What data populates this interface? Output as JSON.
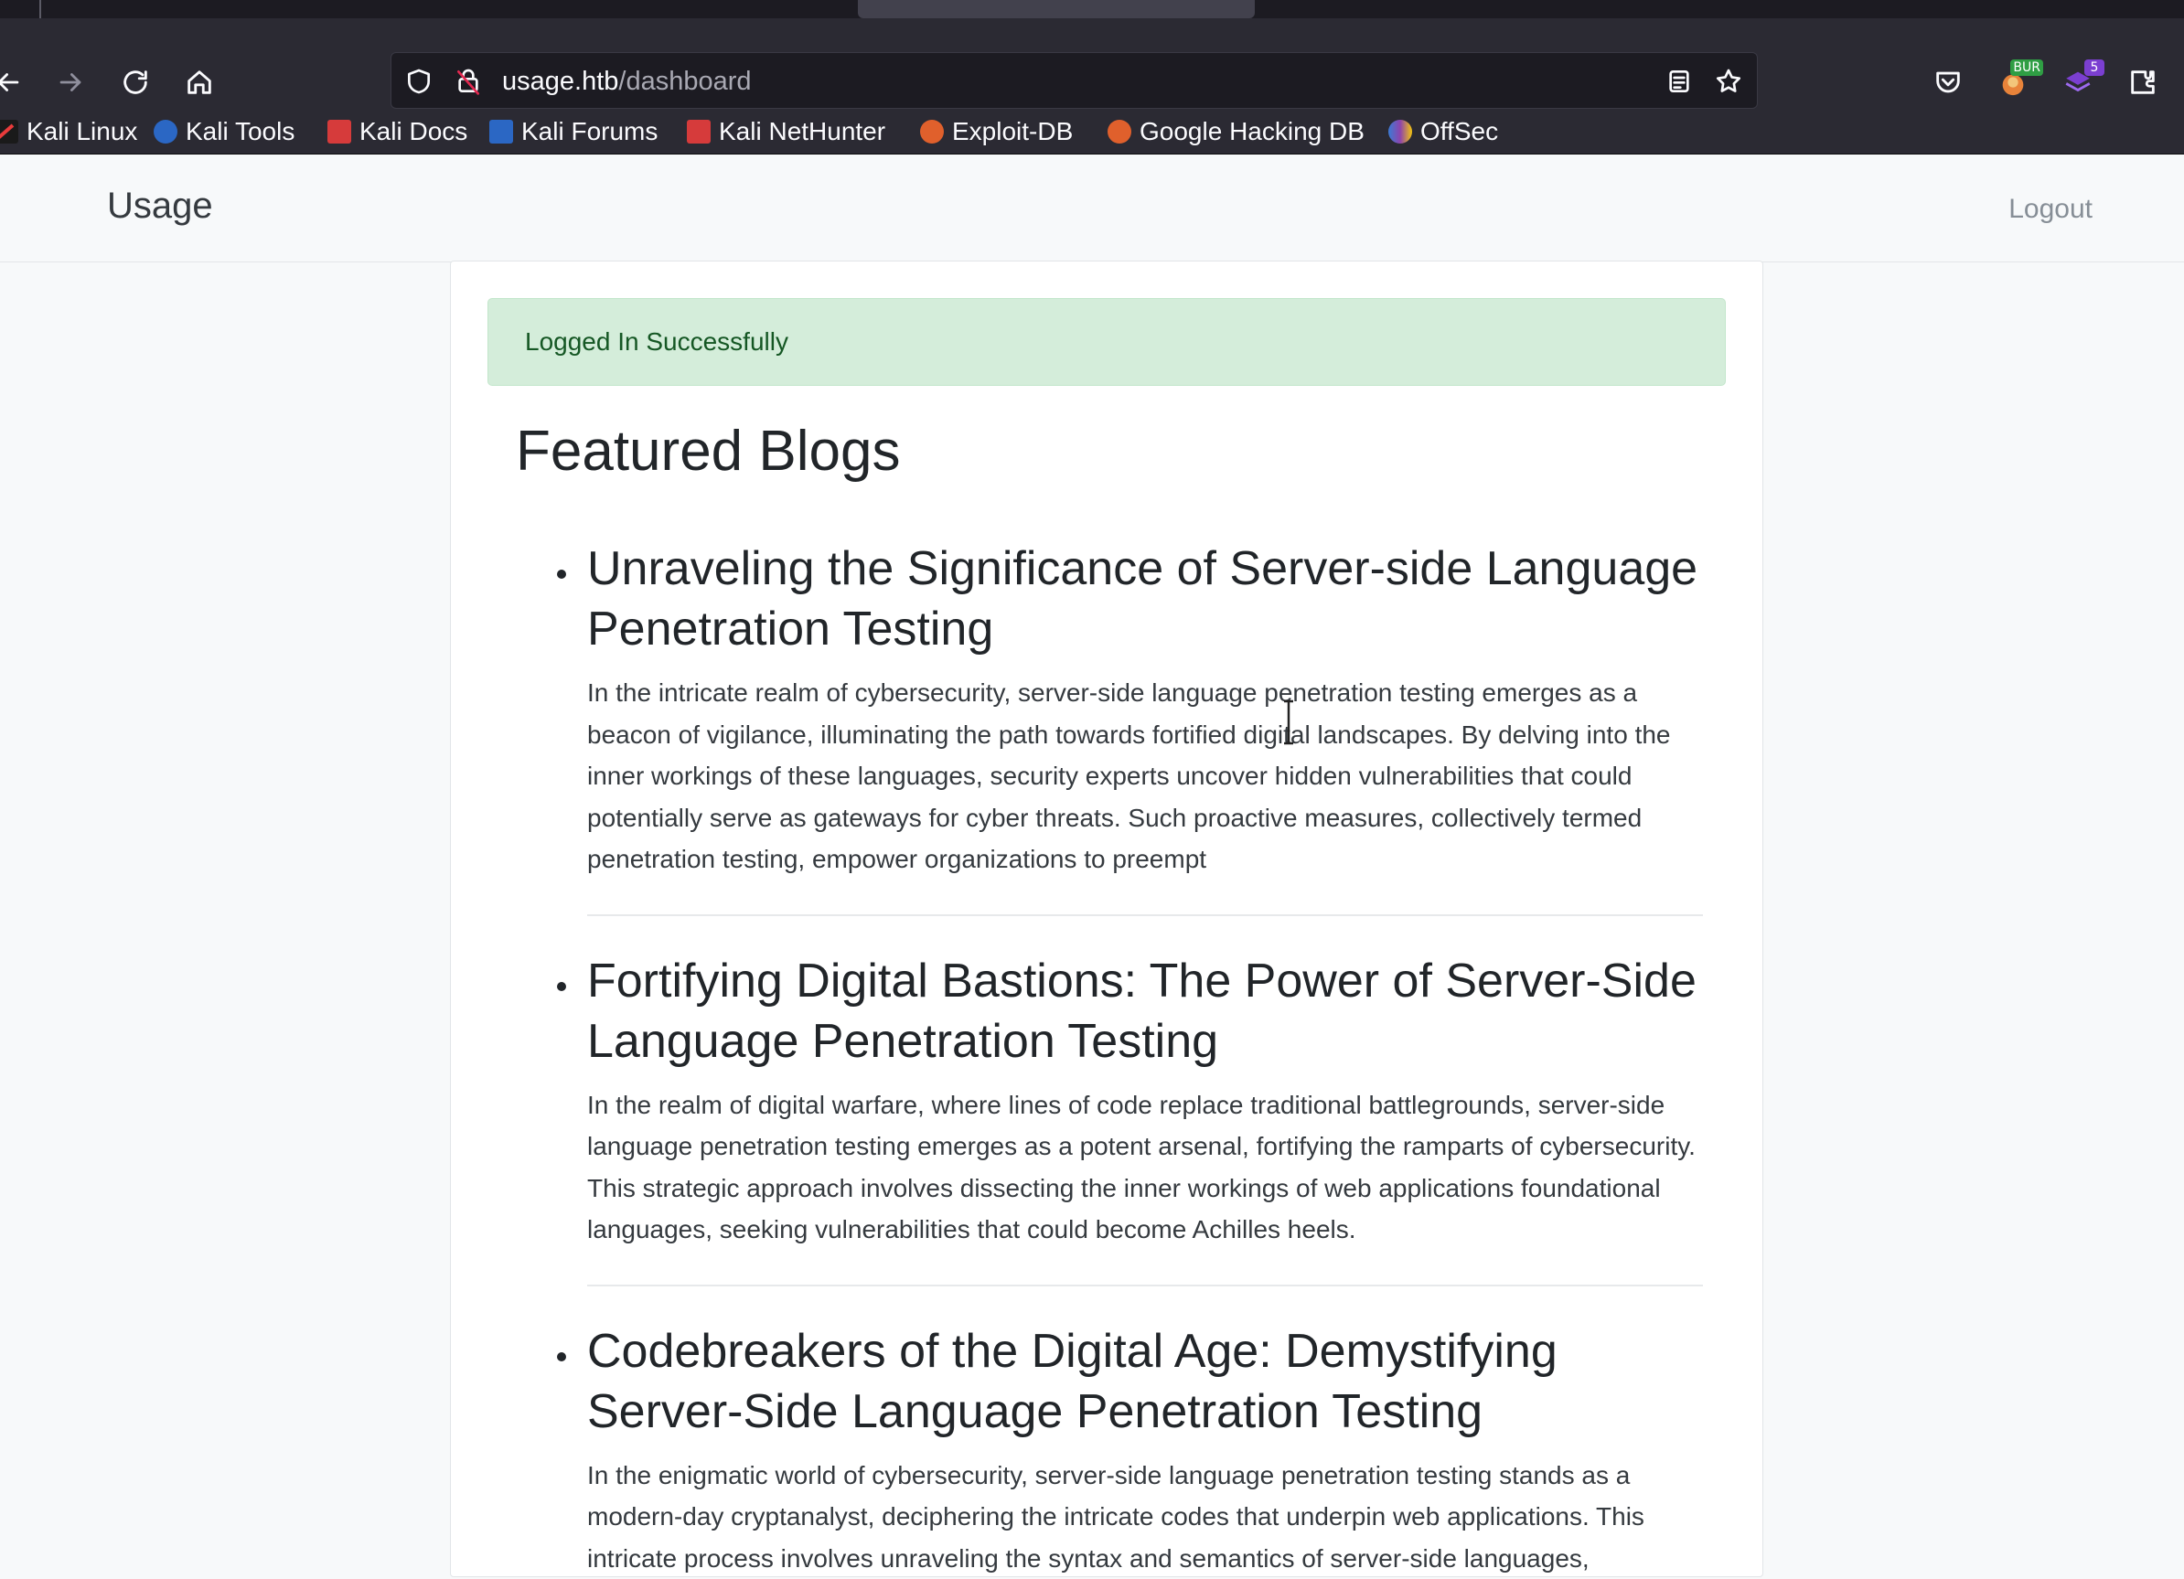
{
  "browser": {
    "url_host": "usage.htb",
    "url_path": "/dashboard",
    "bookmarks": [
      {
        "label": "Kali Linux",
        "icon": "kali-icon"
      },
      {
        "label": "Kali Tools",
        "icon": "kali-tools-icon"
      },
      {
        "label": "Kali Docs",
        "icon": "kali-docs-icon"
      },
      {
        "label": "Kali Forums",
        "icon": "kali-forums-icon"
      },
      {
        "label": "Kali NetHunter",
        "icon": "kali-nethunter-icon"
      },
      {
        "label": "Exploit-DB",
        "icon": "exploit-db-icon"
      },
      {
        "label": "Google Hacking DB",
        "icon": "ghdb-icon"
      },
      {
        "label": "OffSec",
        "icon": "offsec-icon"
      }
    ],
    "extensions": {
      "burp_badge": "BUR",
      "ext_count": "5"
    },
    "icons": {
      "back": "back-arrow-icon",
      "forward": "forward-arrow-icon",
      "reload": "reload-icon",
      "home": "home-icon",
      "shield": "tracking-shield-icon",
      "lock": "insecure-lock-icon",
      "reader": "reader-view-icon",
      "bookmark": "star-icon",
      "pocket": "pocket-icon",
      "extensions": "extensions-icon"
    }
  },
  "site": {
    "brand": "Usage",
    "logout_label": "Logout"
  },
  "alert": {
    "message": "Logged In Successfully",
    "color": "#d4edda"
  },
  "main": {
    "title": "Featured Blogs",
    "posts": [
      {
        "title": "Unraveling the Significance of Server-side Language Penetration Testing",
        "body": "In the intricate realm of cybersecurity, server-side language penetration testing emerges as a beacon of vigilance, illuminating the path towards fortified digital landscapes. By delving into the inner workings of these languages, security experts uncover hidden vulnerabilities that could potentially serve as gateways for cyber threats. Such proactive measures, collectively termed penetration testing, empower organizations to preempt"
      },
      {
        "title": "Fortifying Digital Bastions: The Power of Server-Side Language Penetration Testing",
        "body": "In the realm of digital warfare, where lines of code replace traditional battlegrounds, server-side language penetration testing emerges as a potent arsenal, fortifying the ramparts of cybersecurity. This strategic approach involves dissecting the inner workings of web applications foundational languages, seeking vulnerabilities that could become Achilles heels."
      },
      {
        "title": "Codebreakers of the Digital Age: Demystifying Server-Side Language Penetration Testing",
        "body": "In the enigmatic world of cybersecurity, server-side language penetration testing stands as a modern-day cryptanalyst, deciphering the intricate codes that underpin web applications. This intricate process involves unraveling the syntax and semantics of server-side languages,"
      }
    ]
  }
}
